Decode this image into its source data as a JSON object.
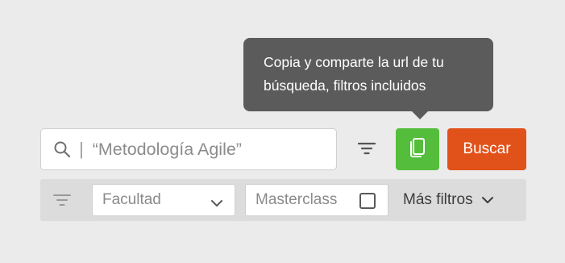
{
  "tooltip": {
    "line1": "Copia y comparte la url de tu",
    "line2": "búsqueda, filtros incluidos"
  },
  "search": {
    "icon": "search-icon",
    "divider": "|",
    "placeholder": "“Metodología Agile”"
  },
  "toolbar": {
    "filter_icon": "filter-icon",
    "copy_icon": "copy-icon",
    "search_button_label": "Buscar"
  },
  "filters": {
    "facultad_label": "Facultad",
    "masterclass_label": "Masterclass",
    "masterclass_checked": false,
    "more_filters_label": "Más filtros"
  },
  "colors": {
    "background": "#ebebeb",
    "tooltip_bg": "#5b5b5b",
    "copy_button": "#55bd3c",
    "search_button": "#e1521a",
    "filter_bar": "#dcdcdc"
  }
}
